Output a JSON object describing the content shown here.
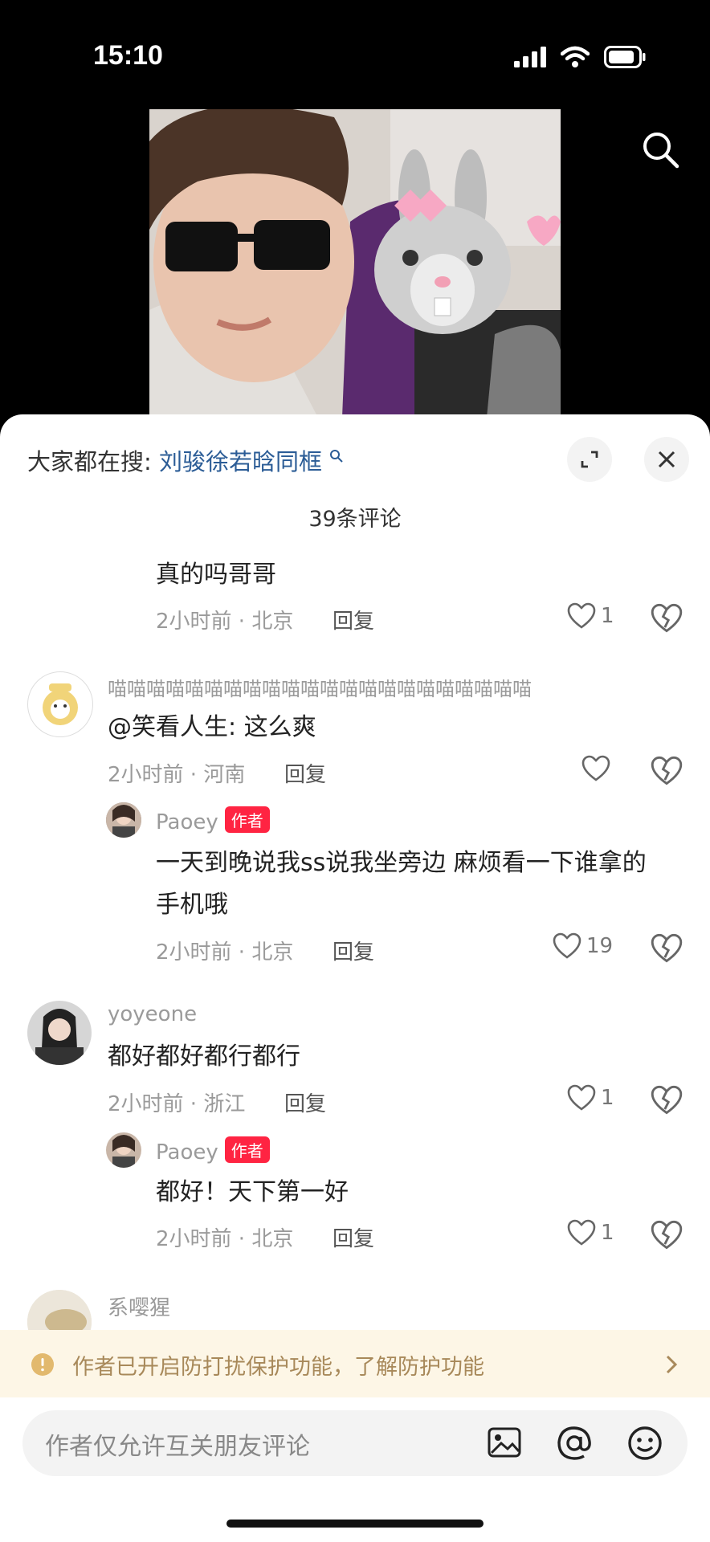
{
  "status_bar": {
    "time": "15:10"
  },
  "header": {
    "trending_label": "大家都在搜:",
    "trending_query": "刘骏徐若晗同框",
    "comment_count": "39条评论"
  },
  "comments": [
    {
      "text": "真的吗哥哥",
      "time_location": "2小时前 · 北京",
      "reply_label": "回复",
      "likes": "1"
    },
    {
      "username": "喵喵喵喵喵喵喵喵喵喵喵喵喵喵喵喵喵喵喵喵喵喵",
      "text": "@笑看人生: 这么爽",
      "time_location": "2小时前 · 河南",
      "reply_label": "回复",
      "likes": ""
    },
    {
      "username": "Paoey",
      "tag": "作者",
      "text_line1": "一天到晚说我ss说我坐旁边 麻烦看一下谁拿的",
      "text_line2": "手机哦",
      "time_location": "2小时前 · 北京",
      "reply_label": "回复",
      "likes": "19"
    },
    {
      "username": "yoyeone",
      "text": "都好都好都行都行",
      "time_location": "2小时前 · 浙江",
      "reply_label": "回复",
      "likes": "1"
    },
    {
      "username": "Paoey",
      "tag": "作者",
      "text": "都好！天下第一好",
      "time_location": "2小时前 · 北京",
      "reply_label": "回复",
      "likes": "1"
    },
    {
      "username": "系嘤猩"
    }
  ],
  "notice": {
    "text": "作者已开启防打扰保护功能，了解防护功能"
  },
  "input": {
    "placeholder": "作者仅允许互关朋友评论"
  },
  "colors": {
    "accent": "#ff2442",
    "link": "#2b5c96",
    "notice_bg": "#fdf6e6"
  }
}
